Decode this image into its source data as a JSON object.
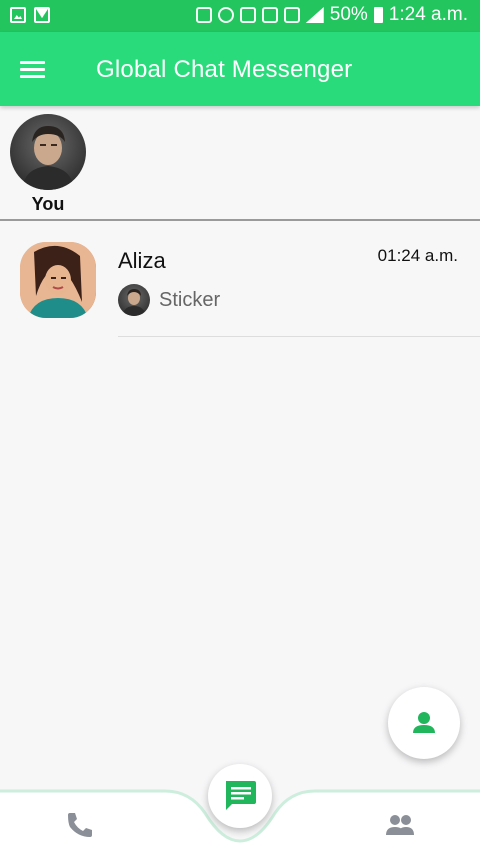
{
  "status_bar": {
    "battery": "50%",
    "time": "1:24 a.m."
  },
  "app_bar": {
    "title": "Global Chat Messenger"
  },
  "stories": [
    {
      "label": "You"
    }
  ],
  "chats": [
    {
      "name": "Aliza",
      "time": "01:24 a.m.",
      "last_message": "Sticker"
    }
  ],
  "colors": {
    "status_bar": "#22c55e",
    "app_bar": "#2adb7c",
    "accent": "#22c55e",
    "icon_muted": "#8a8f98"
  },
  "icons": {
    "menu": "menu-icon",
    "fab": "person-icon",
    "calls": "phone-icon",
    "chats": "chat-icon",
    "contacts": "group-icon"
  }
}
